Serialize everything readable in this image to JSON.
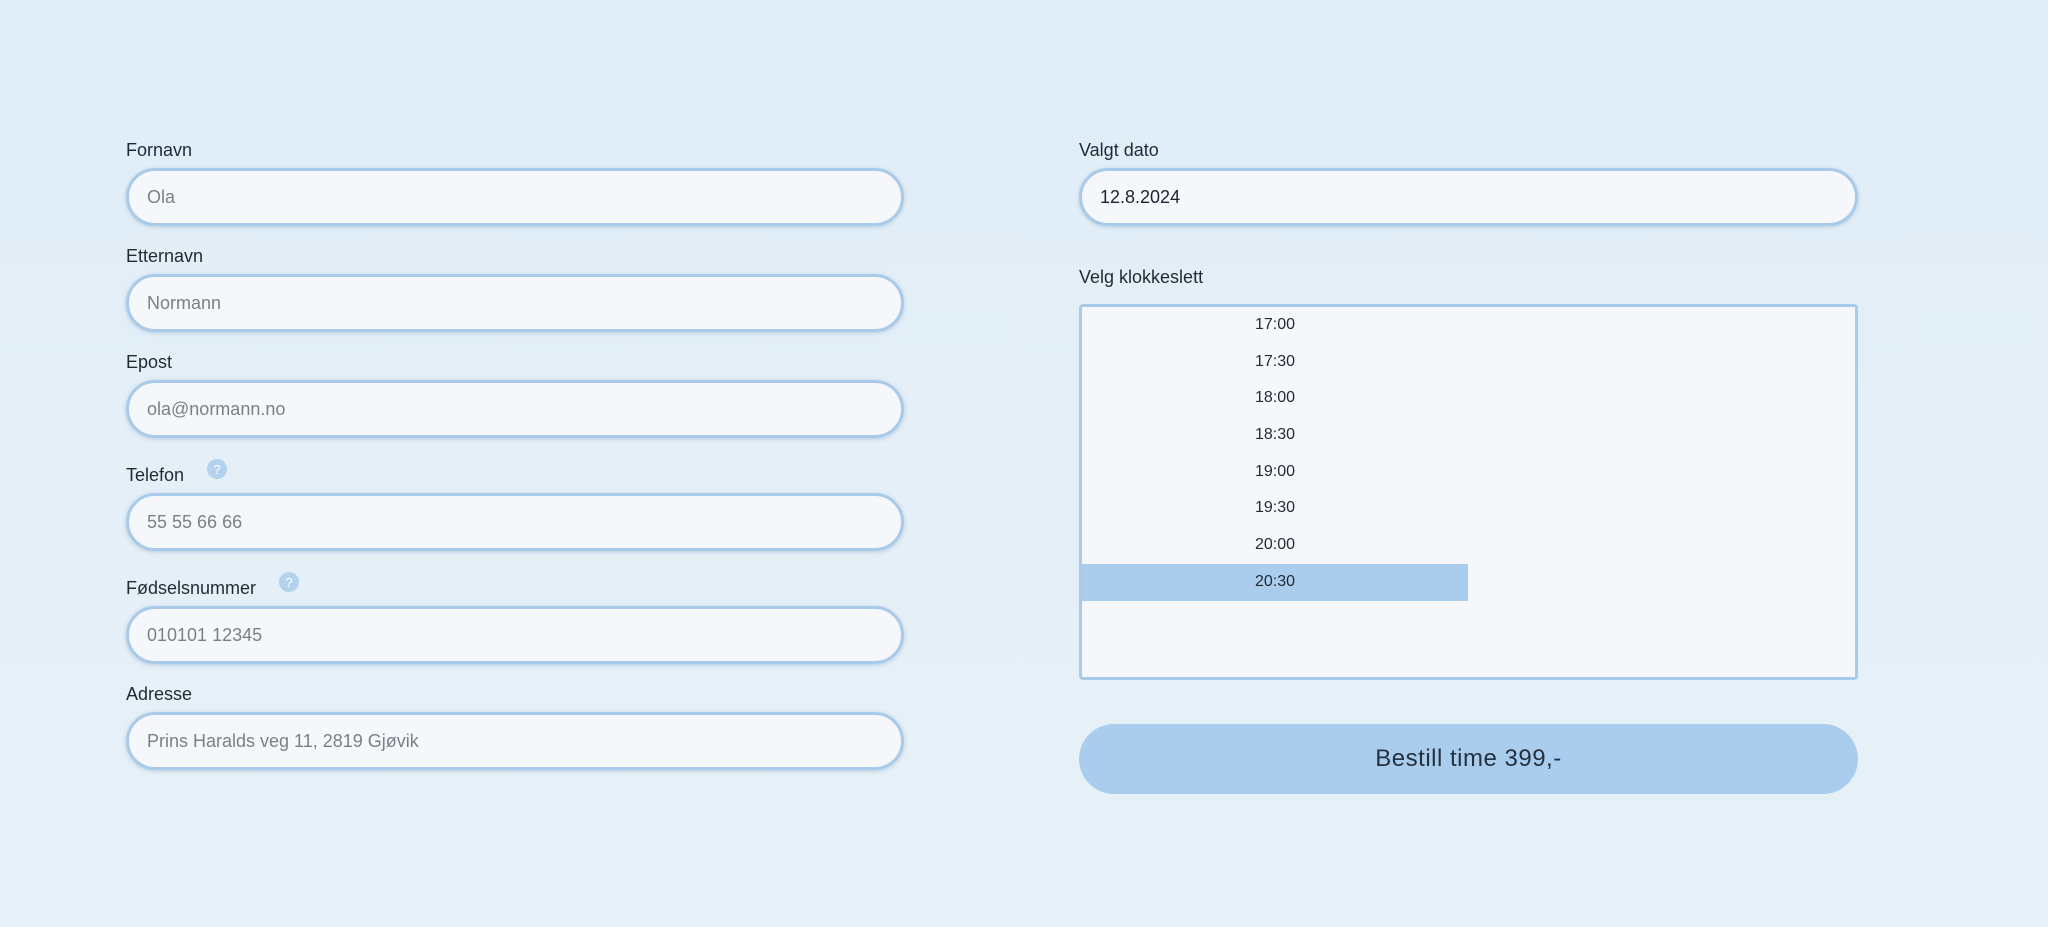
{
  "form": {
    "first_name": {
      "label": "Fornavn",
      "placeholder": "Ola"
    },
    "last_name": {
      "label": "Etternavn",
      "placeholder": "Normann"
    },
    "email": {
      "label": "Epost",
      "placeholder": "ola@normann.no"
    },
    "phone": {
      "label": "Telefon",
      "placeholder": "55 55 66 66",
      "help": "?"
    },
    "ssn": {
      "label": "Fødselsnummer",
      "placeholder": "010101 12345",
      "help": "?"
    },
    "address": {
      "label": "Adresse",
      "placeholder": "Prins Haralds veg 11, 2819 Gjøvik"
    }
  },
  "booking": {
    "date_label": "Valgt dato",
    "date_value": "12.8.2024",
    "time_label": "Velg klokkeslett",
    "times": [
      "17:00",
      "17:30",
      "18:00",
      "18:30",
      "19:00",
      "19:30",
      "20:00",
      "20:30"
    ],
    "selected_time": "20:30",
    "order_button": "Bestill time 399,-"
  },
  "colors": {
    "accent": "#aacdee",
    "border": "#a9cbe9",
    "field_bg": "#f5f7fb",
    "page_bg": "#e3eff7"
  }
}
